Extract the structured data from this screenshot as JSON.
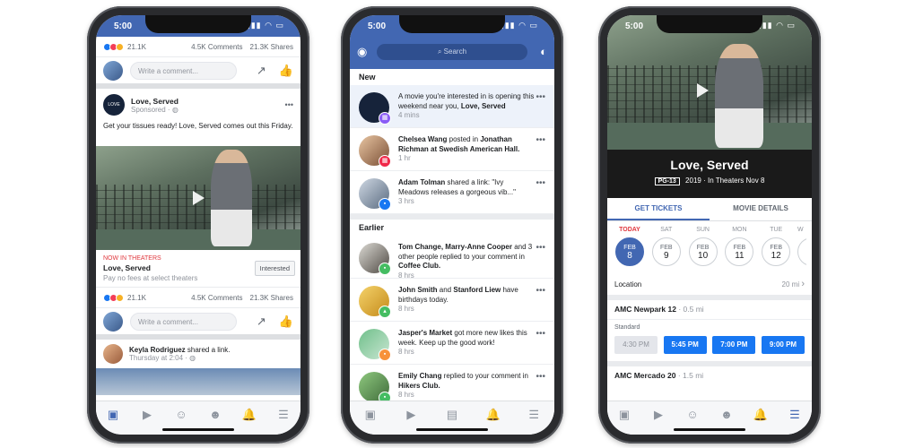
{
  "status": {
    "time": "5:00"
  },
  "phone1": {
    "top_reactions": {
      "count": "21.1K",
      "comments": "4.5K Comments",
      "shares": "21.3K Shares"
    },
    "comment_placeholder": "Write a comment...",
    "post": {
      "page_name": "Love, Served",
      "sponsored": "Sponsored · ",
      "text": "Get your tissues ready! Love, Served comes out this Friday.",
      "cta_kicker": "NOW IN THEATERS",
      "cta_title": "Love, Served",
      "cta_sub": "Pay no fees at select theaters",
      "cta_button": "Interested"
    },
    "bottom_reactions": {
      "count": "21.1K",
      "comments": "4.5K Comments",
      "shares": "21.3K Shares"
    },
    "next_post": {
      "author": "Keyla Rodriguez",
      "action": " shared a link.",
      "time": "Thursday at 2:04 · "
    }
  },
  "phone2": {
    "search_placeholder": "Search",
    "section_new": "New",
    "section_earlier": "Earlier",
    "notifications_new": [
      {
        "pre": "A movie you're interested in is opening this weekend near you, ",
        "bold": "Love, Served",
        "post": "",
        "time": "4 mins",
        "unread": true
      },
      {
        "pre": "",
        "bold": "Chelsea Wang",
        "post": " posted in ",
        "bold2": "Jonathan Richman at Swedish American Hall.",
        "time": "1 hr",
        "unread": false
      },
      {
        "pre": "",
        "bold": "Adam Tolman",
        "post": " shared a link: \"Ivy Meadows releases a gorgeous vib...\"",
        "time": "3 hrs",
        "unread": false
      }
    ],
    "notifications_earlier": [
      {
        "pre": "",
        "bold": "Tom Change, Marry-Anne Cooper",
        "post": " and 3 other people replied to your comment in ",
        "bold2": "Coffee Club.",
        "time": "8 hrs"
      },
      {
        "pre": "",
        "bold": "John Smith",
        "post": " and ",
        "bold2": "Stanford Liew",
        "post2": " have birthdays today.",
        "time": "8 hrs"
      },
      {
        "pre": "",
        "bold": "Jasper's Market",
        "post": " got more new likes this week. Keep up the good work!",
        "time": "8 hrs"
      },
      {
        "pre": "",
        "bold": "Emily Chang",
        "post": " replied to your comment in ",
        "bold2": "Hikers Club.",
        "time": "8 hrs"
      }
    ]
  },
  "phone3": {
    "movie_title": "Love, Served",
    "rating": "PG-13",
    "year": "2019",
    "release": "In Theaters Nov 8",
    "tabs": [
      "GET TICKETS",
      "MOVIE DETAILS"
    ],
    "dates": [
      {
        "day": "TODAY",
        "mon": "FEB",
        "num": "8",
        "selected": true
      },
      {
        "day": "SAT",
        "mon": "FEB",
        "num": "9",
        "selected": false
      },
      {
        "day": "SUN",
        "mon": "FEB",
        "num": "10",
        "selected": false
      },
      {
        "day": "MON",
        "mon": "FEB",
        "num": "11",
        "selected": false
      },
      {
        "day": "TUE",
        "mon": "FEB",
        "num": "12",
        "selected": false
      },
      {
        "day": "W",
        "mon": "F",
        "num": "",
        "selected": false
      }
    ],
    "location_label": "Location",
    "location_value": "20 mi",
    "theater1": {
      "name": "AMC Newpark 12",
      "dist": " · 0.5 mi"
    },
    "format": "Standard",
    "showtimes": [
      {
        "time": "4:30 PM",
        "past": true
      },
      {
        "time": "5:45 PM",
        "past": false
      },
      {
        "time": "7:00 PM",
        "past": false
      },
      {
        "time": "9:00 PM",
        "past": false
      }
    ],
    "theater2": {
      "name": "AMC Mercado 20",
      "dist": " · 1.5 mi"
    }
  },
  "icons": {
    "news-feed": "▣",
    "watch": "▶",
    "profile": "☺",
    "groups": "☻",
    "notifications": "🔔",
    "menu": "☰",
    "marketplace": "▤",
    "share": "↗",
    "like": "👍",
    "more": "•••",
    "globe": "◍",
    "camera": "◉",
    "messenger": "◐",
    "search": "⌕",
    "chevron": "›"
  },
  "colors": {
    "fb_blue": "#4267b2",
    "cta_red": "#e0383e",
    "showtime_blue": "#1877f2"
  }
}
